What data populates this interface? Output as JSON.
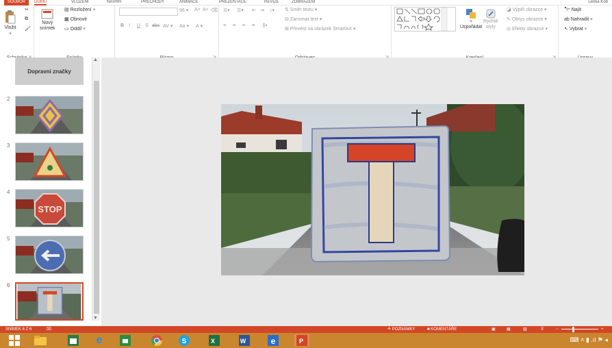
{
  "tabs": {
    "file": "SOUBOR",
    "items": [
      "DOMŮ",
      "VLOŽENÍ",
      "NÁVRH",
      "PŘECHODY",
      "ANIMACE",
      "PREZENTACE",
      "REVIZE",
      "ZOBRAZENÍ"
    ],
    "user": "Lenka Kob"
  },
  "ribbon": {
    "clipboard": {
      "paste": "Vložit",
      "group": "Schránka"
    },
    "slides": {
      "new_slide_1": "Nový",
      "new_slide_2": "snímek",
      "layout": "Rozložení",
      "reset": "Obnovit",
      "section": "Oddíl",
      "group": "Snímky"
    },
    "font": {
      "size": "96",
      "bold": "B",
      "italic": "I",
      "underline": "U",
      "strike": "S",
      "spacing": "abc",
      "case": "Aa",
      "group": "Písmo"
    },
    "paragraph": {
      "direction": "Směr textu",
      "align_text": "Zarovnat text",
      "smartart": "Převést na obrázek SmartArt",
      "group": "Odstavec"
    },
    "drawing": {
      "arrange": "Uspořádat",
      "quick_styles_1": "Rychlé",
      "quick_styles_2": "styly",
      "fill": "Výplň obrazce",
      "outline": "Obrys obrazce",
      "effects": "Efekty obrazce",
      "group": "Kreslení"
    },
    "editing": {
      "find": "Najít",
      "replace": "Nahradit",
      "select": "Vybrat",
      "group": "Úpravy"
    }
  },
  "slides": [
    {
      "num": "",
      "title": "Dopravní značky"
    },
    {
      "num": "2"
    },
    {
      "num": "3"
    },
    {
      "num": "4"
    },
    {
      "num": "5"
    },
    {
      "num": "6"
    }
  ],
  "thumb4_text": "STOP",
  "status": {
    "slide_info": "SNÍMEK 6 Z 6",
    "notes": "POZNÁMKY",
    "comments": "KOMENTÁŘE"
  },
  "colors": {
    "accent": "#d24726",
    "taskbar": "#c9862f",
    "editor_bg": "#e9e9e9"
  }
}
